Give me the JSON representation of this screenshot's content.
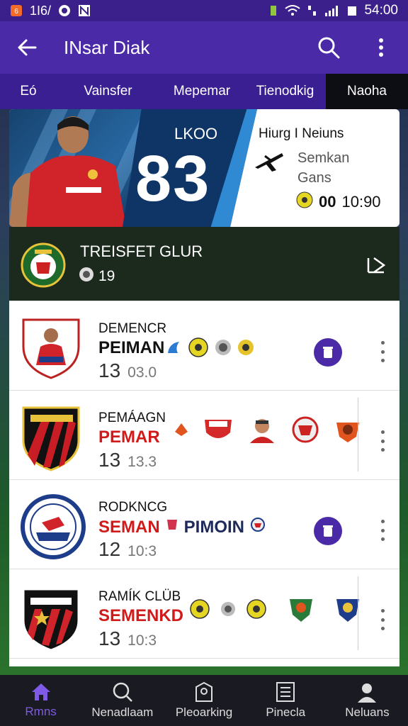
{
  "status_bar": {
    "left_text": "1I6/",
    "time": "54:00"
  },
  "app_bar": {
    "title": "INsar Diak"
  },
  "tabs": [
    {
      "label": "Eó"
    },
    {
      "label": "Vainsfer"
    },
    {
      "label": "Mepemar"
    },
    {
      "label": "Tienodkig"
    },
    {
      "label": "Naoha"
    }
  ],
  "hero": {
    "label": "LKOO",
    "score": "83",
    "info_title": "Hiurg I Neiuns",
    "info_sub1": "Semkan",
    "info_sub2": "Gans",
    "stat_value": "00",
    "stat_extra": "10:90"
  },
  "club_banner": {
    "title": "TREISFET GLUR",
    "count": "19"
  },
  "rows": [
    {
      "team": "DEMENCR",
      "name_a": "PEIMAN",
      "name_b": "",
      "stat_big": "13",
      "stat_small": "03.0",
      "name_color": "#111111"
    },
    {
      "team": "PEMÁAGN",
      "name_a": "PEMAR",
      "name_b": "",
      "stat_big": "13",
      "stat_small": "13.3",
      "name_color": "#d11a1a"
    },
    {
      "team": "RODKNCG",
      "name_a": "SEMAN",
      "name_b": "PIMOIN",
      "stat_big": "12",
      "stat_small": "10:3",
      "name_color": "#d11a1a"
    },
    {
      "team": "RAMÍK CLÜB",
      "name_a": "SEMENKD",
      "name_b": "",
      "stat_big": "13",
      "stat_small": "10:3",
      "name_color": "#d11a1a"
    }
  ],
  "bottom_nav": [
    {
      "label": "Rmns",
      "icon": "home-icon"
    },
    {
      "label": "Nenadlaam",
      "icon": "search-icon"
    },
    {
      "label": "Pleoarking",
      "icon": "badge-icon"
    },
    {
      "label": "Pinecla",
      "icon": "list-icon"
    },
    {
      "label": "Neluans",
      "icon": "person-icon"
    }
  ],
  "colors": {
    "primary": "#4a2aa6",
    "status_bar": "#3b1f8a",
    "accent": "#7e5ae6",
    "red": "#d11a1a"
  }
}
